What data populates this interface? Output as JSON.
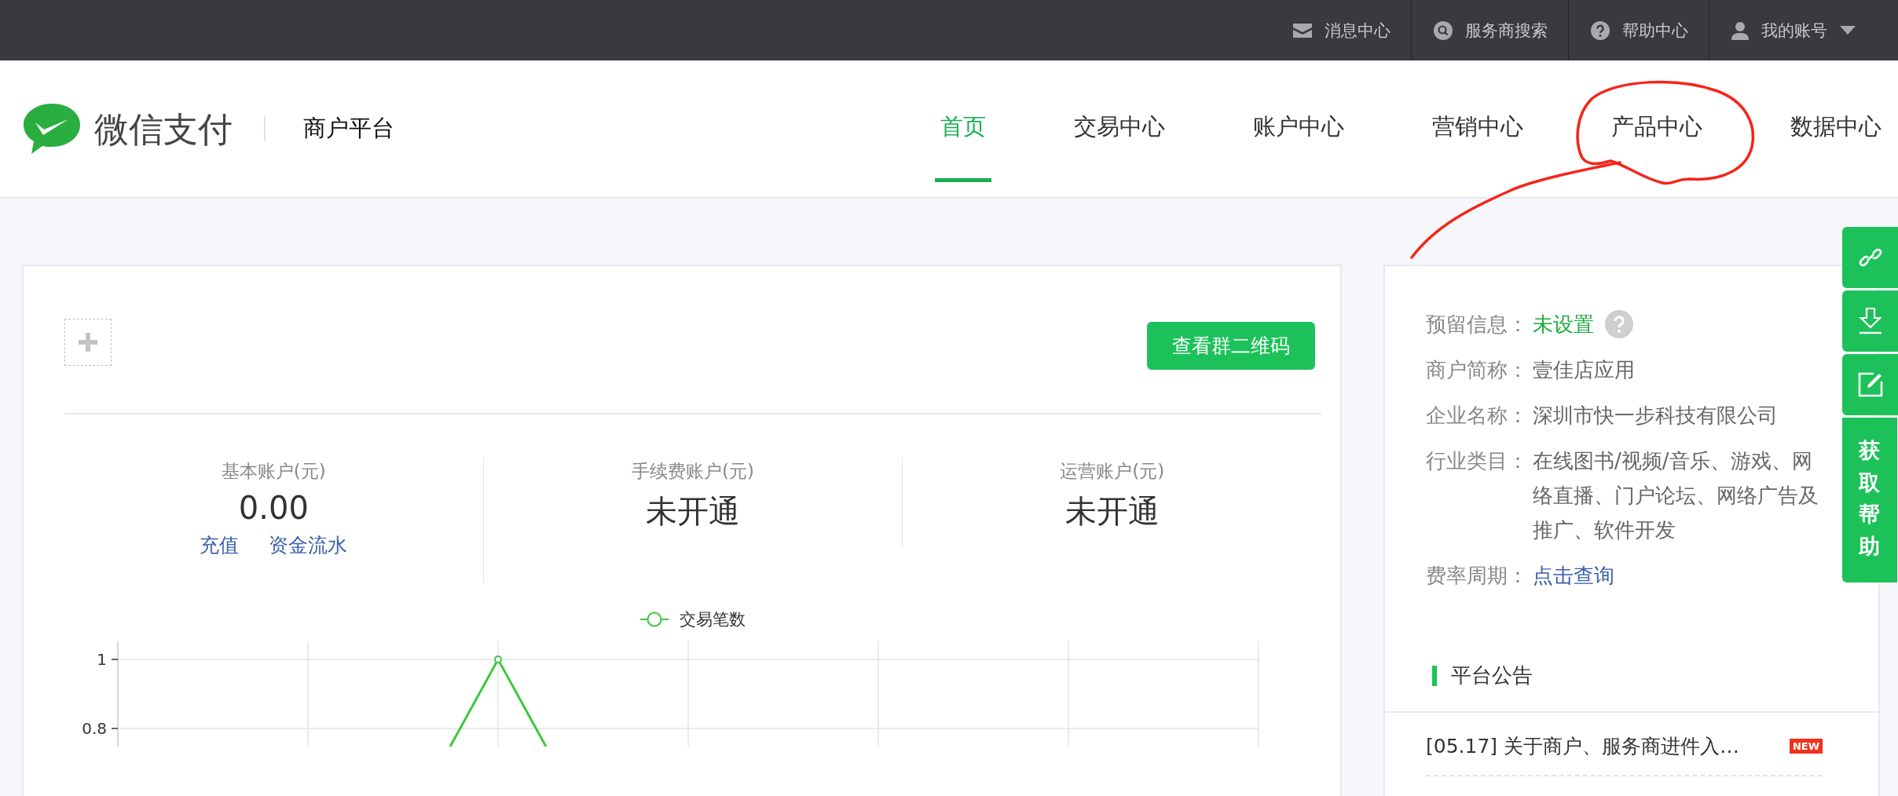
{
  "top_bar": {
    "items": [
      {
        "kind": "mail",
        "label": "消息中心"
      },
      {
        "kind": "search",
        "label": "服务商搜索"
      },
      {
        "kind": "help",
        "label": "帮助中心"
      },
      {
        "kind": "account",
        "label": "我的账号"
      }
    ]
  },
  "header": {
    "brand": "微信支付",
    "subtitle": "商户平台",
    "nav": [
      {
        "label": "首页",
        "selected": true
      },
      {
        "label": "交易中心",
        "selected": false
      },
      {
        "label": "账户中心",
        "selected": false
      },
      {
        "label": "营销中心",
        "selected": false
      },
      {
        "label": "产品中心",
        "selected": false
      },
      {
        "label": "数据中心",
        "selected": false
      }
    ]
  },
  "toolbar": {
    "button": "查看群二维码"
  },
  "accounts": [
    {
      "label": "基本账户(元)",
      "value": "0.00",
      "links": [
        "充值",
        "资金流水"
      ]
    },
    {
      "label": "手续费账户(元)",
      "value": "未开通"
    },
    {
      "label": "运营账户(元)",
      "value": "未开通"
    }
  ],
  "chart": {
    "legend": "交易笔数",
    "ytick_labels": [
      "1",
      "0.8"
    ]
  },
  "merchant_info": {
    "rows": [
      {
        "kind": "status",
        "label": "预留信息：",
        "value": "未设置"
      },
      {
        "kind": "text",
        "label": "商户简称：",
        "value": "壹佳店应用"
      },
      {
        "kind": "text",
        "label": "企业名称：",
        "value": "深圳市快一步科技有限公司"
      },
      {
        "kind": "text",
        "label": "行业类目：",
        "value": "在线图书/视频/音乐、游戏、网络直播、门户论坛、网络广告及推广、软件开发"
      },
      {
        "kind": "link",
        "label": "费率周期：",
        "value": "点击查询"
      }
    ]
  },
  "announcements": {
    "title": "平台公告",
    "items": [
      {
        "text": "[05.17] 关于商户、服务商进件入…",
        "badge": "NEW"
      }
    ]
  },
  "float_tabs": {
    "items": [
      {
        "kind": "link"
      },
      {
        "kind": "download"
      },
      {
        "kind": "edit"
      }
    ],
    "help_label": "获取帮助"
  }
}
